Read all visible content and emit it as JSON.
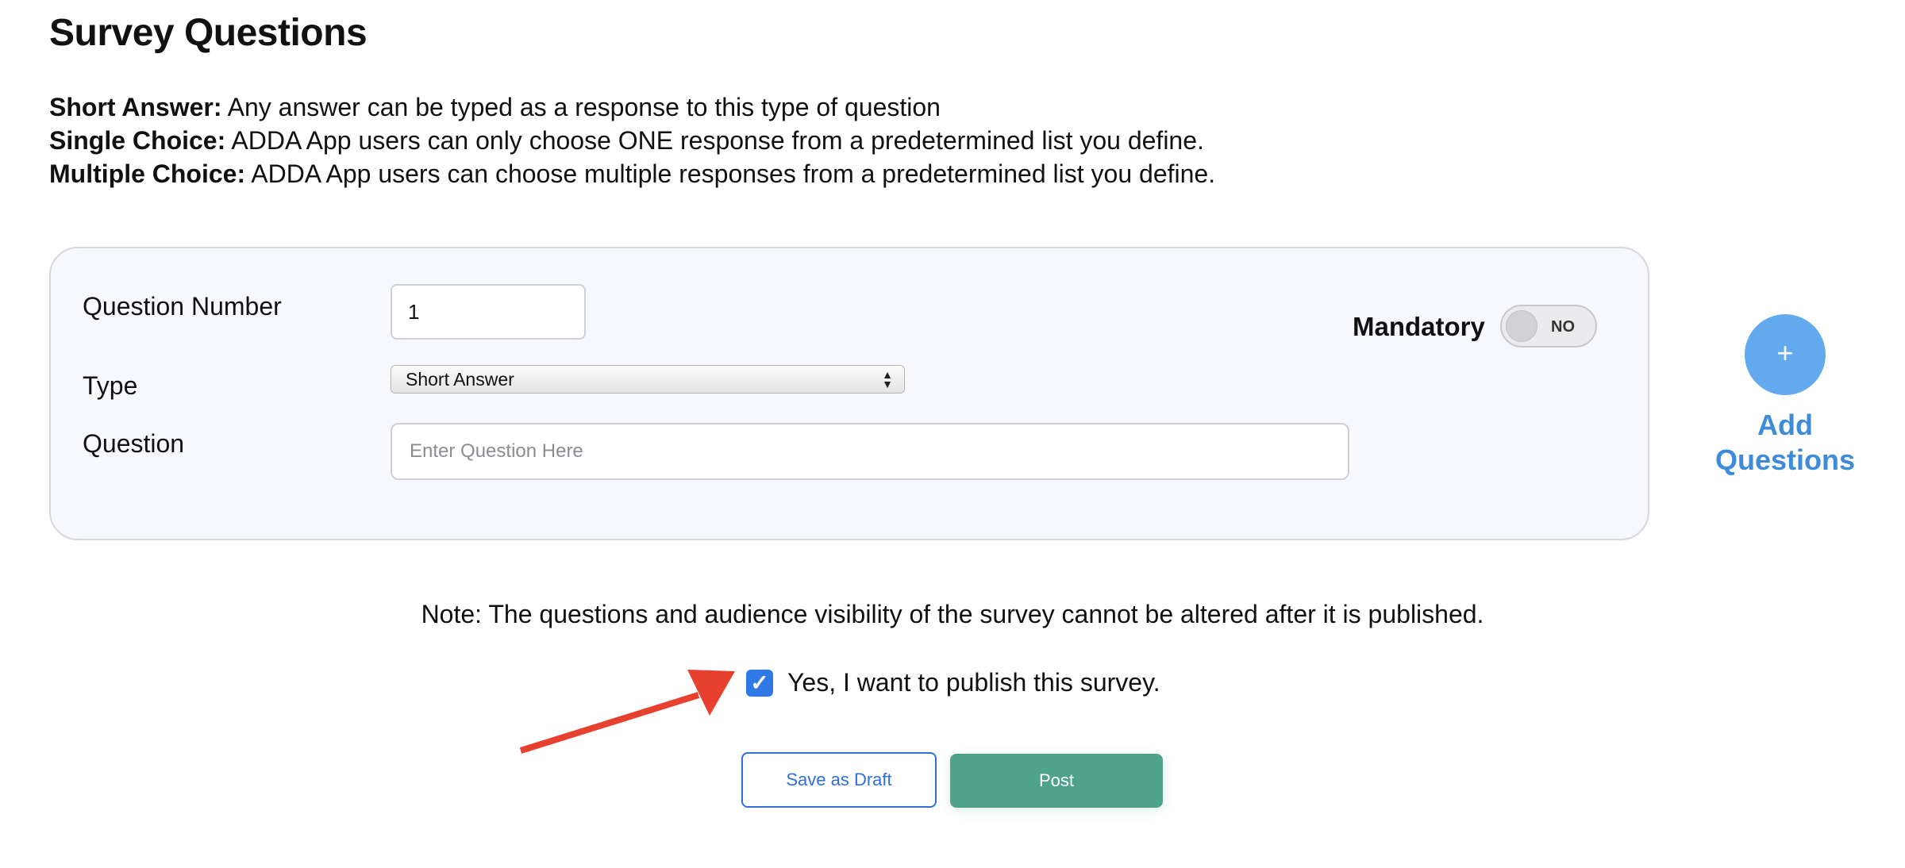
{
  "page": {
    "title": "Survey Questions"
  },
  "definitions": [
    {
      "term": "Short Answer:",
      "text": " Any answer can be typed as a response to this type of question"
    },
    {
      "term": "Single Choice:",
      "text": " ADDA App users can only choose ONE response from a predetermined list you define."
    },
    {
      "term": "Multiple Choice:",
      "text": " ADDA App users can choose multiple responses from a predetermined list you define."
    }
  ],
  "question_form": {
    "number_label": "Question Number",
    "number_value": "1",
    "type_label": "Type",
    "type_selected": "Short Answer",
    "question_label": "Question",
    "question_placeholder": "Enter Question Here",
    "mandatory_label": "Mandatory",
    "mandatory_state": "NO"
  },
  "add_questions": {
    "icon": "+",
    "label": "Add Questions"
  },
  "footer": {
    "note": "Note: The questions and audience visibility of the survey cannot be altered after it is published.",
    "publish_checked": true,
    "publish_label": "Yes, I want to publish this survey.",
    "save_draft_label": "Save as Draft",
    "post_label": "Post"
  },
  "colors": {
    "accent_blue": "#2f6fd6",
    "post_green": "#4ea38a",
    "add_button": "#63a9ee",
    "arrow_red": "#e8402f"
  }
}
